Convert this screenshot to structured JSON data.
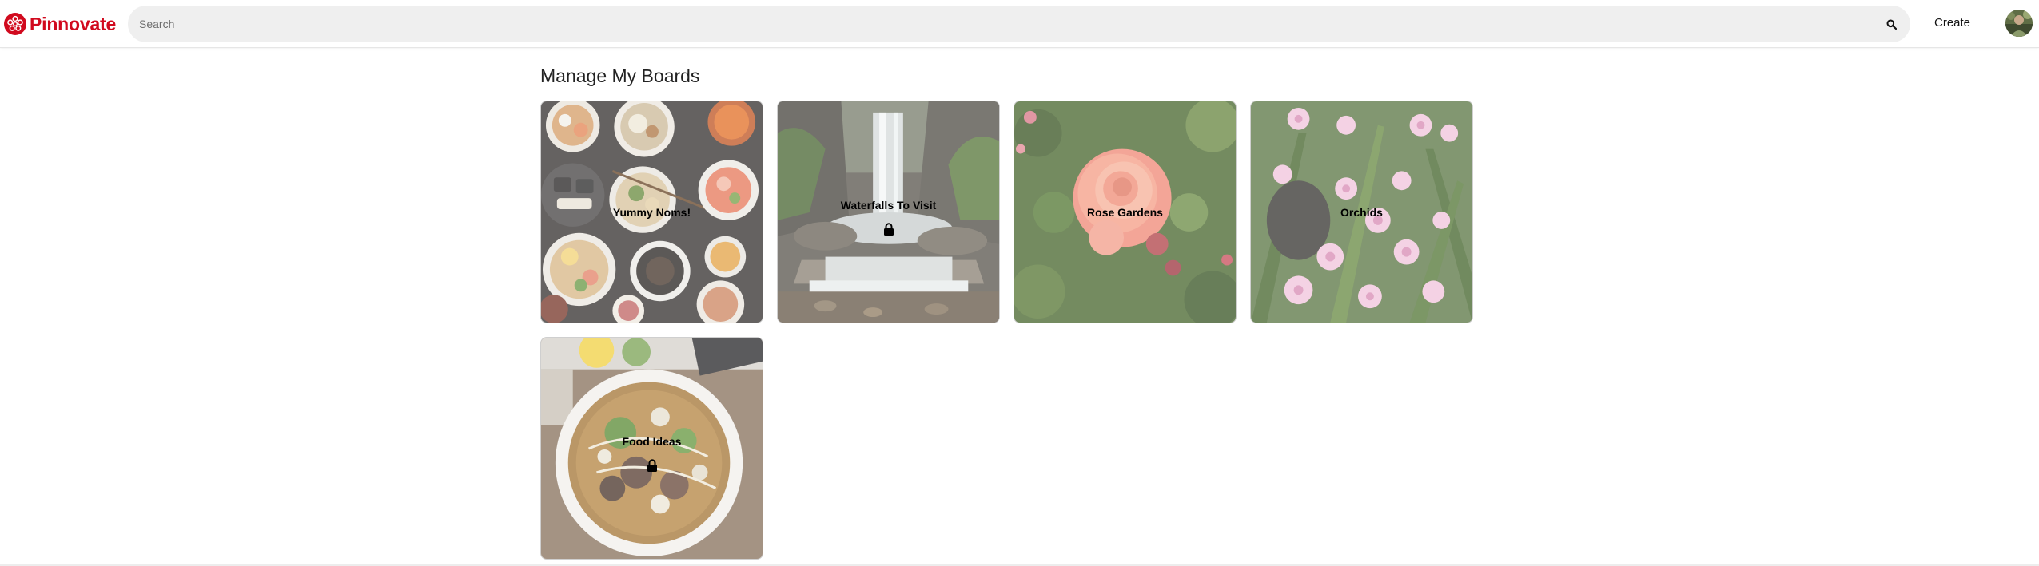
{
  "header": {
    "brand_name": "Pinnovate",
    "brand_color": "#d10a1e",
    "logo_icon": "flower-logo-icon",
    "search": {
      "placeholder": "Search",
      "value": "",
      "icon": "search-icon"
    },
    "create_label": "Create",
    "avatar": "user-avatar"
  },
  "main": {
    "title": "Manage My Boards",
    "boards": [
      {
        "name": "Yummy Noms!",
        "private": false,
        "image": "food-bowls"
      },
      {
        "name": "Waterfalls To Visit",
        "private": true,
        "image": "waterfall"
      },
      {
        "name": "Rose Gardens",
        "private": false,
        "image": "rose"
      },
      {
        "name": "Orchids",
        "private": false,
        "image": "orchids"
      },
      {
        "name": "Food Ideas",
        "private": true,
        "image": "pho-soup"
      }
    ]
  }
}
